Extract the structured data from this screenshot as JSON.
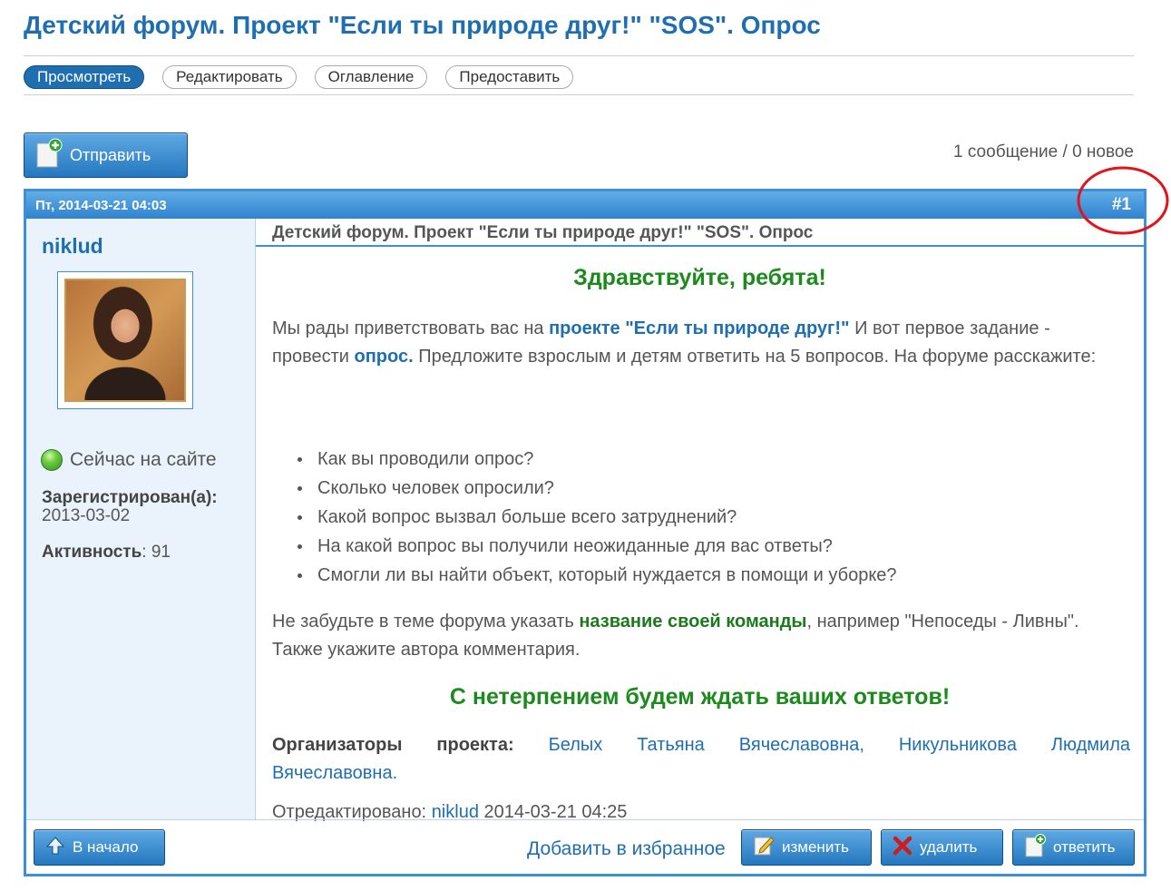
{
  "page": {
    "title": "Детский форум. Проект \"Если ты природе друг!\" \"SOS\". Опрос"
  },
  "tabs": [
    {
      "label": "Просмотреть",
      "active": true
    },
    {
      "label": "Редактировать",
      "active": false
    },
    {
      "label": "Оглавление",
      "active": false
    },
    {
      "label": "Предоставить",
      "active": false
    }
  ],
  "toolbar": {
    "submit_label": "Отправить",
    "post_count": "1 сообщение / 0 новое"
  },
  "post": {
    "date": "Пт, 2014-03-21 04:03",
    "number": "#1",
    "subject": "Детский форум. Проект \"Если ты природе друг!\" \"SOS\". Опрос",
    "author": {
      "username": "niklud",
      "status": "Сейчас на сайте",
      "registered_label": "Зарегистрирован(а):",
      "registered_date": "2013-03-02",
      "activity_label": "Активность",
      "activity_value": ": 91"
    },
    "body": {
      "greeting": "Здравствуйте, ребята!",
      "intro_1": "Мы рады приветствовать вас на ",
      "intro_link_1": "проекте \"Если ты природе друг!\"",
      "intro_2": " И вот первое задание - провести ",
      "intro_link_2": "опрос.",
      "intro_3": " Предложите взрослым и детям ответить на 5 вопросов. На форуме расскажите:",
      "questions": [
        "Как вы проводили опрос?",
        "Сколько человек опросили?",
        "Какой вопрос вызвал больше всего затруднений?",
        "На какой вопрос вы получили неожиданные для вас ответы?",
        "Смогли ли вы найти объект, который нуждается в помощи и уборке?"
      ],
      "reminder_1": "Не забудьте в теме форума указать ",
      "reminder_bold": "название своей команды",
      "reminder_2": ", например \"Непоседы - Ливны\". Также укажите автора комментария.",
      "closing": "С нетерпением будем ждать ваших ответов!",
      "organizers_label": "Организаторы проекта:",
      "organizers_line1": "Белых Татьяна Вячеславовна, Никульникова Людмила",
      "organizers_line2": "Вячеславовна.",
      "edited_label": "Отредактировано: ",
      "edited_user": "niklud",
      "edited_date": " 2014-03-21 04:25"
    },
    "footer": {
      "top_label": "В начало",
      "favorite_label": "Добавить в избранное",
      "edit_label": "изменить",
      "delete_label": "удалить",
      "reply_label": "ответить"
    }
  },
  "colors": {
    "brand_blue": "#1f6fb0",
    "header_blue": "#3e8fd5",
    "green_text": "#1c8a1c",
    "highlight_circle": "#e0141a"
  }
}
